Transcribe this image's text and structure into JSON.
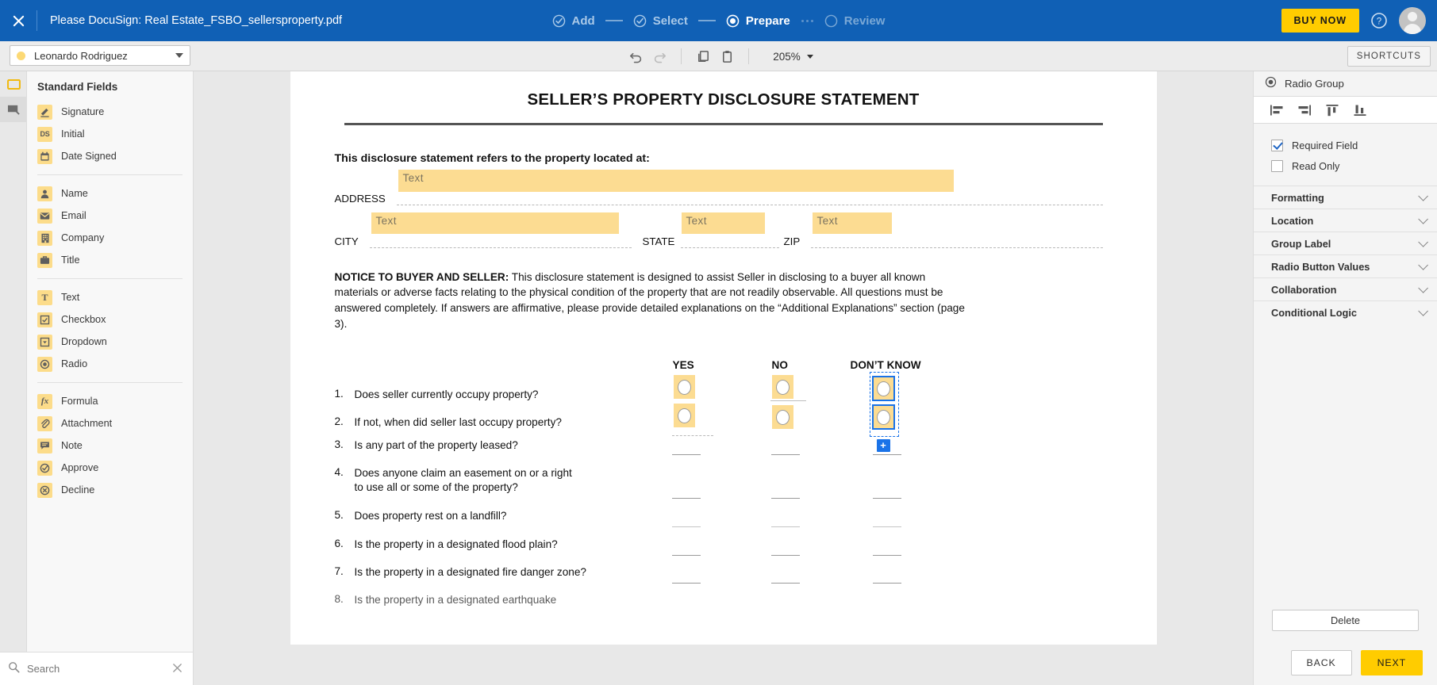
{
  "topbar": {
    "close_icon": "close-icon",
    "title": "Please DocuSign: Real Estate_FSBO_sellersproperty.pdf",
    "steps": [
      {
        "label": "Add",
        "state": "done",
        "icon": "check-circle-icon"
      },
      {
        "label": "Select",
        "state": "done",
        "icon": "check-circle-icon"
      },
      {
        "label": "Prepare",
        "state": "active",
        "icon": "radio-filled-icon"
      },
      {
        "label": "Review",
        "state": "todo",
        "icon": "circle-outline-icon"
      }
    ],
    "buy_now_label": "BUY NOW",
    "help_icon": "help-circle-icon",
    "avatar_icon": "user-avatar-icon",
    "accent_blue": "#1060b5",
    "accent_yellow": "#ffcc00"
  },
  "toolbar": {
    "recipient": "Leonardo Rodriguez",
    "recipient_color": "#fcd975",
    "undo_icon": "undo-icon",
    "redo_icon": "redo-icon",
    "copy_icon": "copy-icon",
    "paste_icon": "paste-icon",
    "zoom_level": "205%",
    "shortcuts_label": "SHORTCUTS"
  },
  "left_rail": [
    {
      "icon": "field-box-icon",
      "selected": false
    },
    {
      "icon": "custom-fields-icon",
      "selected": true
    }
  ],
  "sidebar": {
    "title": "Standard Fields",
    "groups": [
      [
        {
          "label": "Signature",
          "icon": "signature-icon",
          "glyph": "✎"
        },
        {
          "label": "Initial",
          "icon": "initial-icon",
          "glyph": "DS"
        },
        {
          "label": "Date Signed",
          "icon": "calendar-icon",
          "glyph": "▤"
        }
      ],
      [
        {
          "label": "Name",
          "icon": "person-icon",
          "glyph": "●"
        },
        {
          "label": "Email",
          "icon": "envelope-icon",
          "glyph": "✉"
        },
        {
          "label": "Company",
          "icon": "building-icon",
          "glyph": "▦"
        },
        {
          "label": "Title",
          "icon": "briefcase-icon",
          "glyph": "▮"
        }
      ],
      [
        {
          "label": "Text",
          "icon": "text-icon",
          "glyph": "T"
        },
        {
          "label": "Checkbox",
          "icon": "checkbox-icon",
          "glyph": "☑"
        },
        {
          "label": "Dropdown",
          "icon": "dropdown-icon",
          "glyph": "▾"
        },
        {
          "label": "Radio",
          "icon": "radio-icon",
          "glyph": "◉"
        }
      ],
      [
        {
          "label": "Formula",
          "icon": "formula-icon",
          "glyph": "fx"
        },
        {
          "label": "Attachment",
          "icon": "paperclip-icon",
          "glyph": "⁂"
        },
        {
          "label": "Note",
          "icon": "note-icon",
          "glyph": "≡"
        },
        {
          "label": "Approve",
          "icon": "approve-icon",
          "glyph": "✓"
        },
        {
          "label": "Decline",
          "icon": "decline-icon",
          "glyph": "✕"
        }
      ]
    ],
    "search_placeholder": "Search",
    "search_value": "",
    "search_icon": "search-icon",
    "search_clear_icon": "clear-icon"
  },
  "document": {
    "title": "SELLER’S PROPERTY DISCLOSURE STATEMENT",
    "intro": "This disclosure statement refers to the property located at:",
    "address_label": "ADDRESS",
    "city_label": "CITY",
    "state_label": "STATE",
    "zip_label": "ZIP",
    "field_placeholder": "Text",
    "notice_bold": "NOTICE TO BUYER AND SELLER:",
    "notice_body": " This disclosure statement is designed to assist Seller in disclosing to a buyer all known materials or adverse facts relating to the physical condition of the property that are not readily observable. All questions must be answered completely. If answers are affirmative, please provide detailed explanations on the “Additional Explanations” section (page 3).",
    "columns": [
      "YES",
      "NO",
      "DON’T KNOW"
    ],
    "questions": [
      {
        "num": "1.",
        "text": "Does seller currently occupy property?"
      },
      {
        "num": "2.",
        "text": "If not, when did seller last occupy property?"
      },
      {
        "num": "3.",
        "text": "Is any part of the property leased?"
      },
      {
        "num": "4.",
        "text": "Does anyone claim an easement on or a right\nto use all or some of the property?"
      },
      {
        "num": "5.",
        "text": "Does property rest on a landfill?"
      },
      {
        "num": "6.",
        "text": "Is the property in a designated flood plain?"
      },
      {
        "num": "7.",
        "text": " Is the property in a designated fire danger zone?"
      },
      {
        "num": "8.",
        "text": "Is the property in a designated earthquake"
      }
    ],
    "field_color": "#fcdc92",
    "selection_color": "#1a73e8",
    "add_radio_handle": "+"
  },
  "right_panel": {
    "header_label": "Radio Group",
    "header_icon": "radio-group-icon",
    "align_buttons": [
      {
        "icon": "align-left-icon"
      },
      {
        "icon": "align-right-icon"
      },
      {
        "icon": "align-top-icon"
      },
      {
        "icon": "align-bottom-icon"
      }
    ],
    "checkboxes": [
      {
        "label": "Required Field",
        "checked": true
      },
      {
        "label": "Read Only",
        "checked": false
      }
    ],
    "accordions": [
      {
        "label": "Formatting"
      },
      {
        "label": "Location"
      },
      {
        "label": "Group Label"
      },
      {
        "label": "Radio Button Values"
      },
      {
        "label": "Collaboration"
      },
      {
        "label": "Conditional Logic"
      }
    ],
    "delete_label": "Delete"
  },
  "footer": {
    "back_label": "BACK",
    "next_label": "NEXT"
  }
}
